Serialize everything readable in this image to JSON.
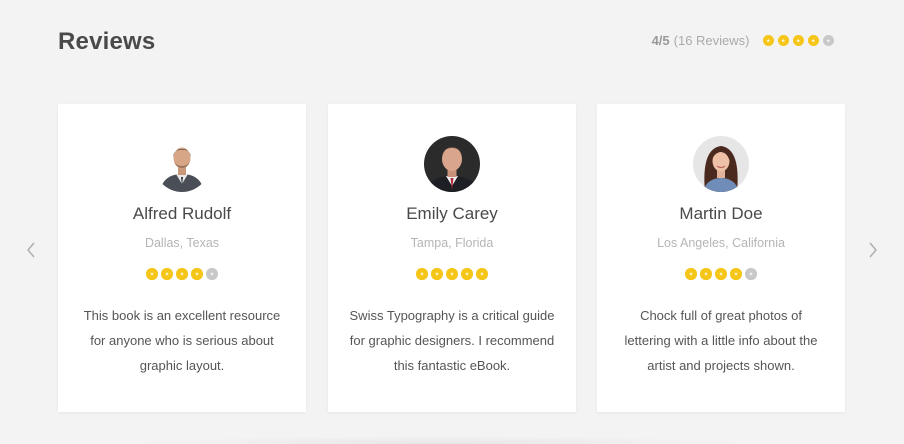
{
  "header": {
    "title": "Reviews",
    "score": "4/5",
    "count": "(16 Reviews)",
    "rating": 4,
    "rating_max": 5
  },
  "nav": {
    "prev_icon": "chevron-left-icon",
    "next_icon": "chevron-right-icon"
  },
  "colors": {
    "star_filled": "#f5c518",
    "star_empty": "#c8c8c8",
    "background": "#f3f3f3"
  },
  "reviews": [
    {
      "name": "Alfred Rudolf",
      "location": "Dallas, Texas",
      "rating": 4,
      "text": "This book is an excellent resource for anyone who is serious about graphic layout."
    },
    {
      "name": "Emily Carey",
      "location": "Tampa, Florida",
      "rating": 5,
      "text": "Swiss Typography is a critical guide for graphic designers. I recommend this fantastic eBook."
    },
    {
      "name": "Martin Doe",
      "location": "Los Angeles, California",
      "rating": 4,
      "text": "Chock full of great photos of lettering with a little info about the artist and projects shown."
    }
  ]
}
